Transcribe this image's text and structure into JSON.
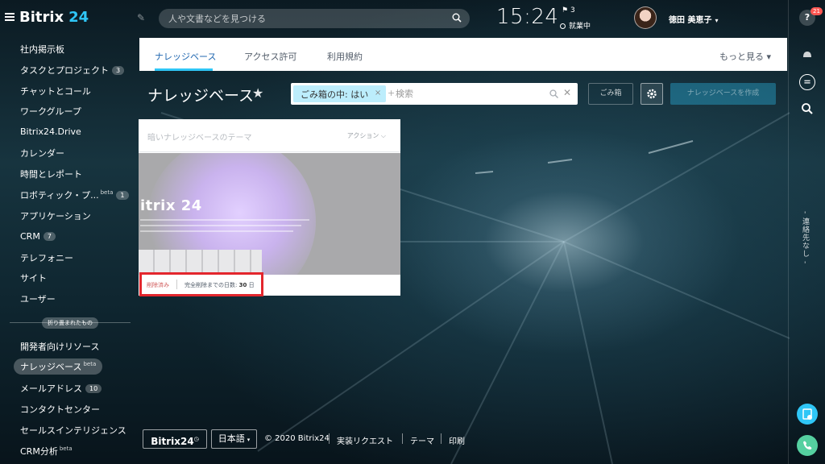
{
  "header": {
    "logo_main": "Bitrix",
    "logo_num": "24",
    "search_placeholder": "人や文書などを見つける",
    "clock": "15:24",
    "flag_count": "3",
    "work_status": "就業中",
    "user_name": "徳田 美恵子"
  },
  "right_rail": {
    "help_badge": "21",
    "vertical_text": "- 連絡先なし -"
  },
  "sidebar": {
    "items": [
      {
        "label": "社内掲示板",
        "badge": "",
        "beta": ""
      },
      {
        "label": "タスクとプロジェクト",
        "badge": "3",
        "beta": ""
      },
      {
        "label": "チャットとコール",
        "badge": "",
        "beta": ""
      },
      {
        "label": "ワークグループ",
        "badge": "",
        "beta": ""
      },
      {
        "label": "Bitrix24.Drive",
        "badge": "",
        "beta": ""
      },
      {
        "label": "カレンダー",
        "badge": "",
        "beta": ""
      },
      {
        "label": "時間とレポート",
        "badge": "",
        "beta": ""
      },
      {
        "label": "ロボティック・プ...",
        "badge": "1",
        "beta": "beta"
      },
      {
        "label": "アプリケーション",
        "badge": "",
        "beta": ""
      },
      {
        "label": "CRM",
        "badge": "7",
        "beta": ""
      },
      {
        "label": "テレフォニー",
        "badge": "",
        "beta": ""
      },
      {
        "label": "サイト",
        "badge": "",
        "beta": ""
      },
      {
        "label": "ユーザー",
        "badge": "",
        "beta": ""
      }
    ],
    "collapsed_label": "折り畳まれたもの",
    "collapsed_items": [
      {
        "label": "開発者向けリソース",
        "badge": "",
        "beta": ""
      },
      {
        "label": "ナレッジベース",
        "badge": "",
        "beta": "beta"
      },
      {
        "label": "メールアドレス",
        "badge": "10",
        "beta": ""
      },
      {
        "label": "コンタクトセンター",
        "badge": "",
        "beta": ""
      },
      {
        "label": "セールスインテリジェンス",
        "badge": "",
        "beta": ""
      },
      {
        "label": "CRM分析",
        "badge": "",
        "beta": "beta"
      }
    ]
  },
  "tabs": {
    "items": [
      "ナレッジベース",
      "アクセス許可",
      "利用規約"
    ],
    "more": "もっと見る"
  },
  "page": {
    "title": "ナレッジベース",
    "filter_tag": "ごみ箱の中: はい",
    "filter_placeholder": "検索",
    "trash_button": "ごみ箱",
    "add_button": "ナレッジベースを作成"
  },
  "card": {
    "title": "暗いナレッジベースのテーマ",
    "action": "アクション",
    "preview_brand": "itrix 24",
    "status": "削除済み",
    "days_label": "完全削除までの日数:",
    "days_value": "30",
    "days_unit": "日"
  },
  "footer": {
    "logo": "Bitrix24",
    "language": "日本語",
    "copyright": "© 2020 Bitrix24",
    "links": [
      "実装リクエスト",
      "テーマ",
      "印刷"
    ]
  },
  "colors": {
    "accent": "#2fc6f6",
    "active_tab": "#2067b0",
    "deleted": "#d05a5a",
    "highlight": "#e3262d"
  }
}
